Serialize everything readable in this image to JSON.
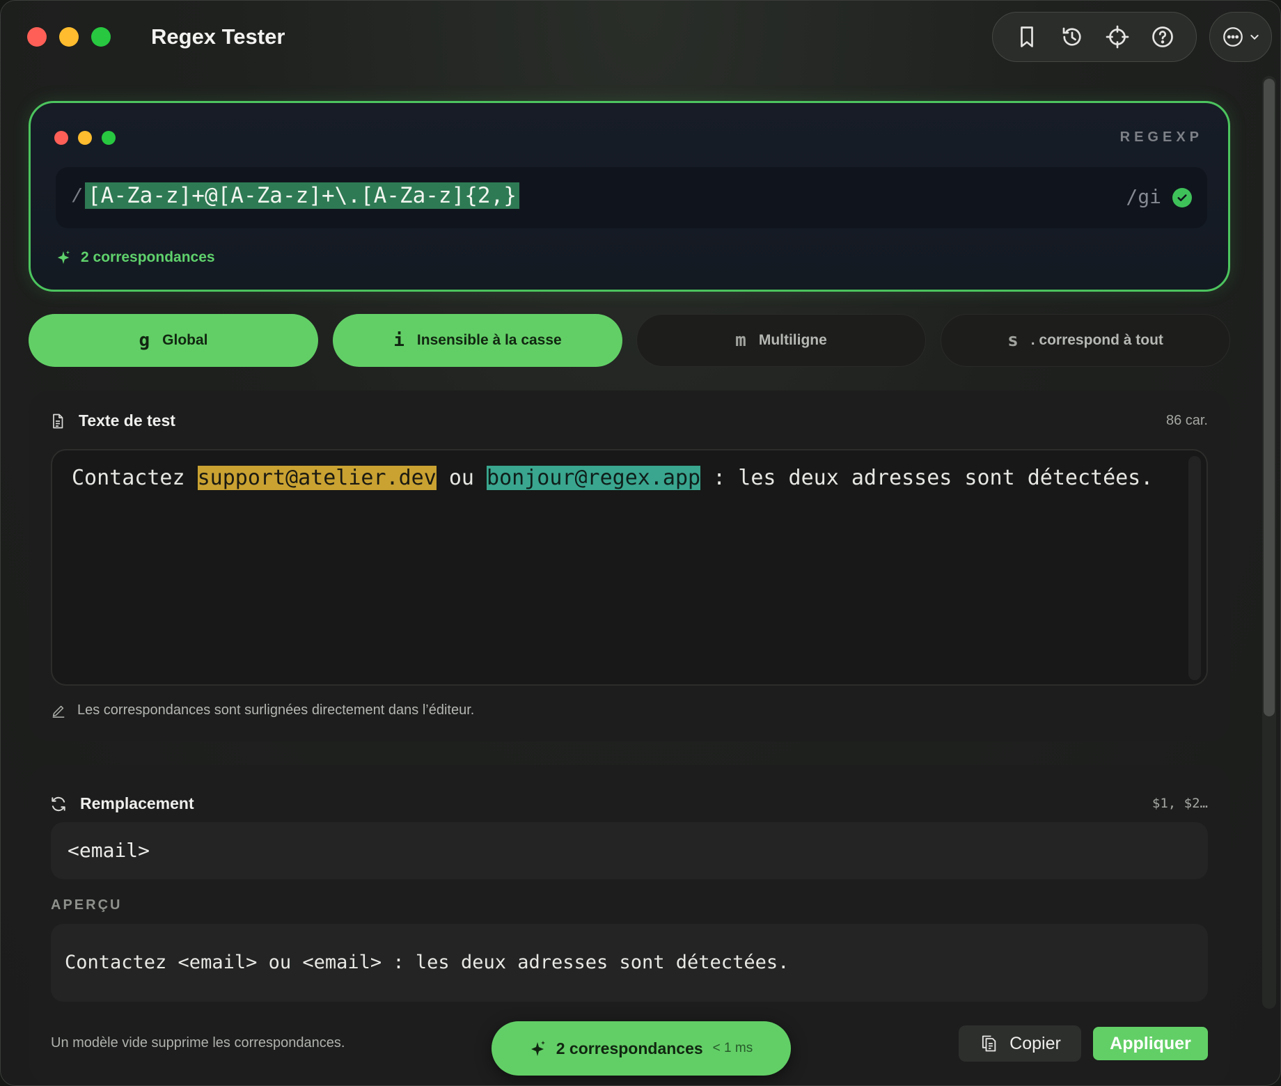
{
  "window": {
    "title": "Regex Tester"
  },
  "toolbar": {
    "icons": [
      "bookmark-icon",
      "history-icon",
      "crosshair-icon",
      "help-icon"
    ],
    "more_icon": "ellipsis-icon"
  },
  "regex": {
    "tag": "REGEXP",
    "slash": "/",
    "pattern": "[A-Za-z]+@[A-Za-z]+\\.[A-Za-z]{2,}",
    "flags": "/gi",
    "valid": true,
    "match_count_label": "2 correspondances"
  },
  "flags": [
    {
      "letter": "g",
      "label": "Global",
      "active": true
    },
    {
      "letter": "i",
      "label": "Insensible à la casse",
      "active": true
    },
    {
      "letter": "m",
      "label": "Multiligne",
      "active": false
    },
    {
      "letter": "s",
      "label": ". correspond à tout",
      "active": false
    }
  ],
  "test_text": {
    "title": "Texte de test",
    "char_count": "86 car.",
    "segments": {
      "before": "Contactez ",
      "match1": "support@atelier.dev",
      "middle": " ou ",
      "match2": "bonjour@regex.app",
      "after": " : les deux adresses sont détectées."
    },
    "highlight_colors": [
      "#c9a232",
      "#3aa68f"
    ],
    "hint": "Les correspondances sont surlignées directement dans l’éditeur."
  },
  "replacement": {
    "title": "Remplacement",
    "meta": "$1, $2…",
    "value": "<email>",
    "preview_label": "APERÇU",
    "preview_text": "Contactez <email> ou <email> : les deux adresses sont détectées."
  },
  "footer": {
    "note": "Un modèle vide supprime les correspondances.",
    "status_count": "2 correspondances",
    "status_time": "< 1 ms",
    "copy_label": "Copier",
    "apply_label": "Appliquer"
  },
  "colors": {
    "accent": "#62cf66",
    "window_bg": "#1f211f"
  }
}
